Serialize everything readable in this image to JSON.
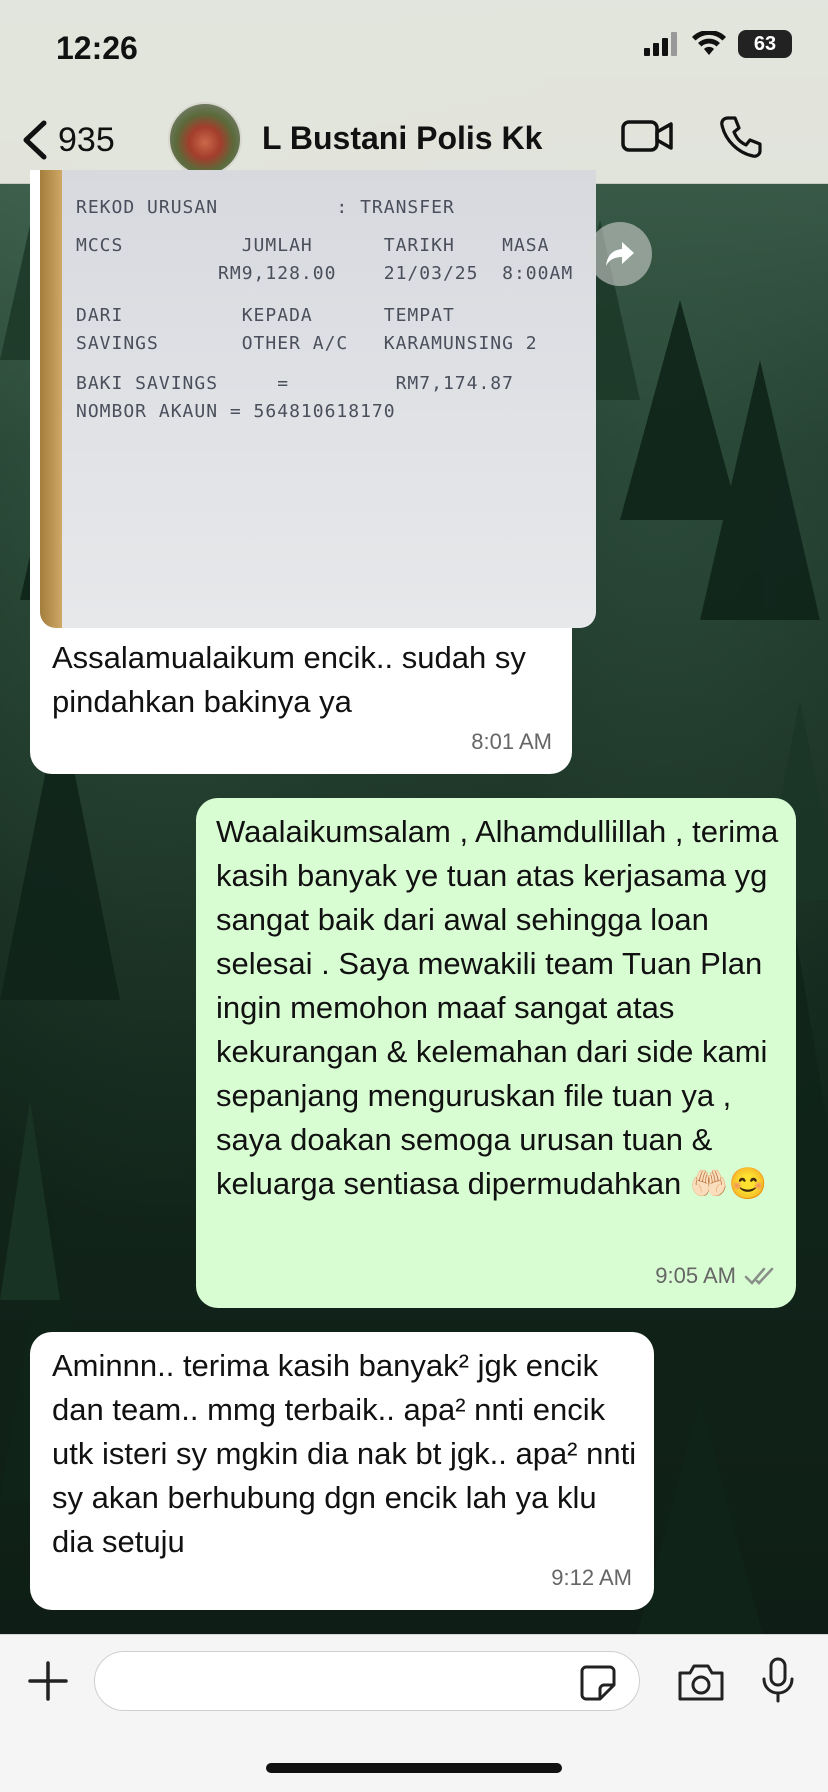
{
  "status_bar": {
    "time": "12:26",
    "battery": "63"
  },
  "header": {
    "back_count": "935",
    "contact_name": "L Bustani Polis Kk"
  },
  "messages": [
    {
      "direction": "incoming",
      "type": "image",
      "receipt_lines": [
        "REKOD URUSAN          : TRANSFER",
        "MCCS          JUMLAH      TARIKH    MASA",
        "            RM9,128.00    21/03/25  8:00AM",
        "DARI          KEPADA      TEMPAT",
        "SAVINGS       OTHER A/C   KARAMUNSING 2",
        "BAKI SAVINGS     =         RM7,174.87",
        "NOMBOR AKAUN = 564810618170"
      ],
      "caption": "Assalamualaikum encik.. sudah sy pindahkan bakinya ya",
      "time": "8:01 AM"
    },
    {
      "direction": "outgoing",
      "text": "Waalaikumsalam , Alhamdullillah , terima kasih banyak ye tuan atas kerjasama yg sangat baik dari awal sehingga loan selesai . Saya mewakili team Tuan Plan ingin memohon maaf sangat atas kekurangan & kelemahan dari side kami sepanjang menguruskan file tuan ya , saya doakan semoga urusan tuan & keluarga sentiasa dipermudahkan 🤲🏻😊",
      "time": "9:05 AM",
      "read_status": "read"
    },
    {
      "direction": "incoming",
      "text": "Aminnn.. terima kasih banyak² jgk encik dan team.. mmg terbaik.. apa² nnti encik utk isteri sy mgkin dia nak bt jgk.. apa² nnti sy akan berhubung dgn encik lah ya klu dia setuju",
      "time": "9:12 AM"
    }
  ],
  "composer": {
    "placeholder": ""
  },
  "colors": {
    "outgoing_bubble": "#d9fdd3",
    "incoming_bubble": "#ffffff",
    "header_bg": "#f0f0e8"
  }
}
